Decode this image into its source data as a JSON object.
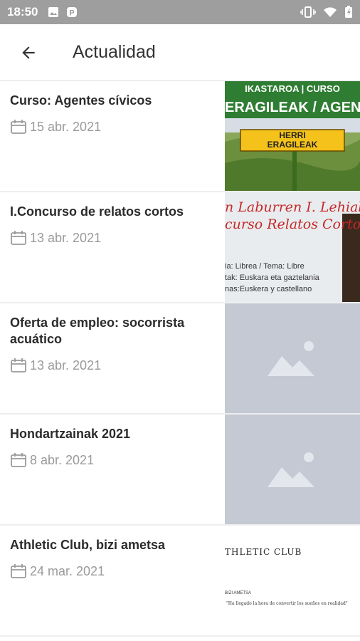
{
  "status": {
    "time": "18:50"
  },
  "appbar": {
    "title": "Actualidad"
  },
  "items": [
    {
      "title": "Curso: Agentes cívicos",
      "date": "15 abr. 2021",
      "thumb": {
        "top": "IKASTAROA | CURSO",
        "band": "ERAGILEAK / AGENTES",
        "sign1": "HERRI",
        "sign2": "ERAGILEAK"
      }
    },
    {
      "title": "I.Concurso de relatos cortos",
      "date": "13 abr. 2021",
      "thumb": {
        "line1": "n Laburren I. Lehiak",
        "line2": "curso Relatos Cortos",
        "s1": "ia: Librea  /  Tema: Libre",
        "s2": "tak: Euskara eta gaztelania",
        "s3": "nas:Euskera y castellano"
      }
    },
    {
      "title": "Oferta de empleo: socorrista acuático",
      "date": "13 abr. 2021"
    },
    {
      "title": "Hondartzainak 2021",
      "date": "8 abr. 2021"
    },
    {
      "title": "Athletic Club, bizi ametsa",
      "date": "24 mar. 2021",
      "thumb": {
        "heading": "THLETIC CLUB",
        "sub": "BIZI AMETSA",
        "quote": "\"Ha llegado la hora de convertir los sueños en realidad\""
      }
    }
  ]
}
